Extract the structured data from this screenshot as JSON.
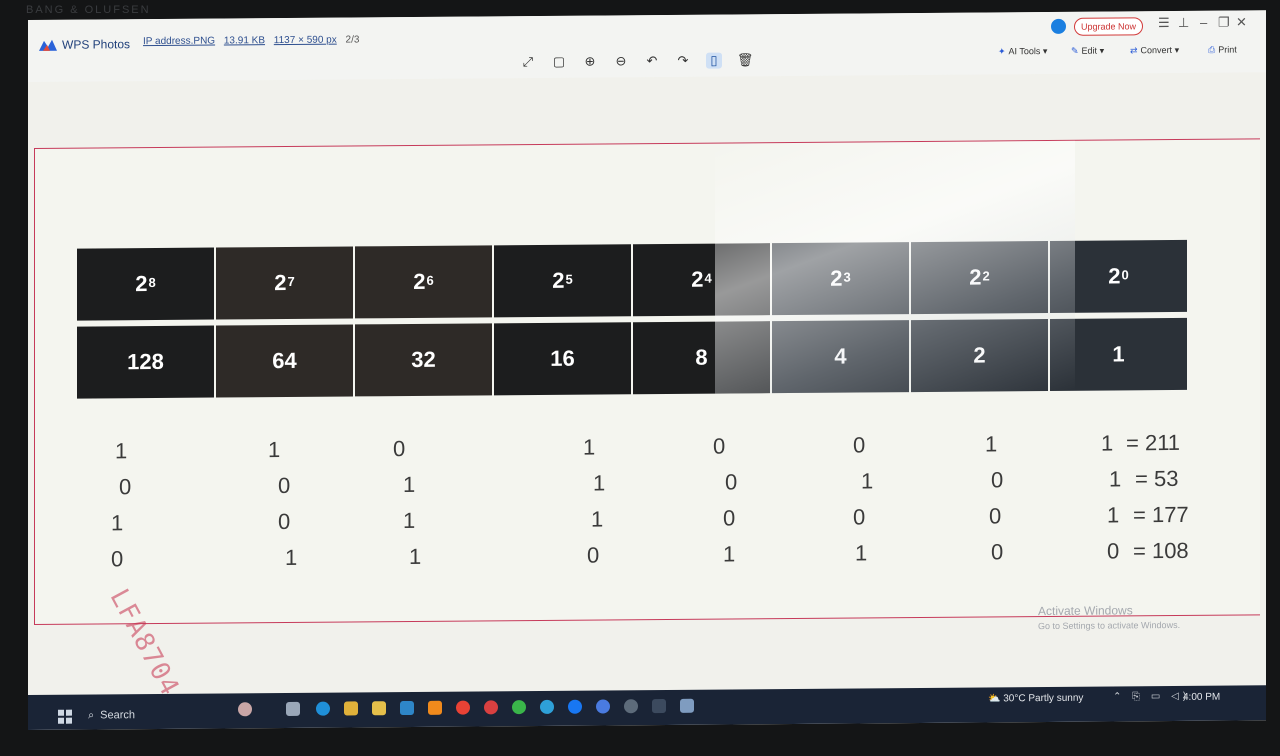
{
  "bezel_brand": "BANG & OLUFSEN",
  "app": {
    "name": "WPS Photos",
    "file_name": "IP address.PNG",
    "file_size": "13.91 KB",
    "dimensions": "1137 × 590 px",
    "counter": "2/3"
  },
  "topbar": {
    "upgrade_label": "Upgrade Now",
    "menu": {
      "ai_tools": "AI Tools",
      "edit": "Edit",
      "convert": "Convert",
      "print": "Print"
    },
    "toolbar_icons": [
      "fullscreen-icon",
      "fit-window-icon",
      "zoom-in-icon",
      "zoom-out-icon",
      "rotate-left-icon",
      "rotate-right-icon",
      "hand-tool-icon",
      "delete-icon"
    ]
  },
  "slide": {
    "powers": [
      {
        "base": "2",
        "exp": "8"
      },
      {
        "base": "2",
        "exp": "7"
      },
      {
        "base": "2",
        "exp": "6"
      },
      {
        "base": "2",
        "exp": "5"
      },
      {
        "base": "2",
        "exp": "4"
      },
      {
        "base": "2",
        "exp": "3"
      },
      {
        "base": "2",
        "exp": "2"
      },
      {
        "base": "2",
        "exp": "0"
      }
    ],
    "values": [
      "128",
      "64",
      "32",
      "16",
      "8",
      "4",
      "2",
      "1"
    ],
    "binary_rows": [
      {
        "bits": [
          "1",
          "1",
          "0",
          "1",
          "0",
          "0",
          "1",
          "1"
        ],
        "result": "= 211"
      },
      {
        "bits": [
          "0",
          "0",
          "1",
          "1",
          "0",
          "1",
          "0",
          "1"
        ],
        "result": "= 53"
      },
      {
        "bits": [
          "1",
          "0",
          "1",
          "1",
          "0",
          "0",
          "0",
          "1"
        ],
        "result": "= 177"
      },
      {
        "bits": [
          "0",
          "1",
          "1",
          "0",
          "1",
          "1",
          "0",
          "0"
        ],
        "result": "= 108"
      }
    ],
    "stamp": "LFA8704",
    "activate_title": "Activate Windows",
    "activate_sub": "Go to Settings to activate Windows."
  },
  "taskbar": {
    "search_label": "Search",
    "weather": "30°C  Partly sunny",
    "time": "4:00 PM"
  }
}
